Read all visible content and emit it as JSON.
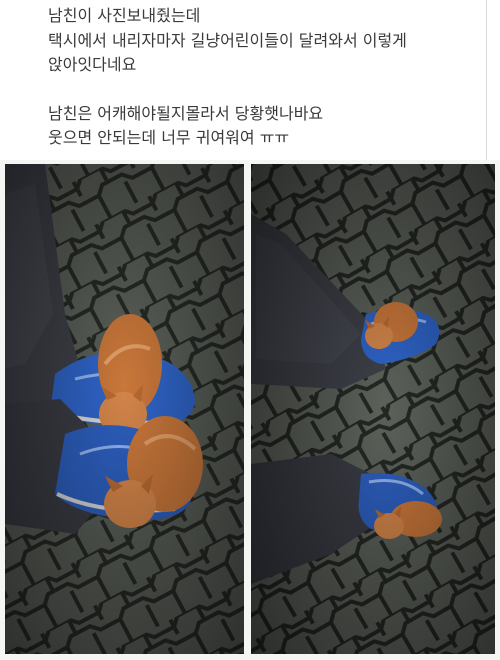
{
  "post": {
    "lines": [
      "남친이 사진보내줬는데",
      "택시에서 내리자마자 길냥어린이들이 달려와서 이렇게",
      "앉아잇다네요",
      "남친은 어캐해야될지몰라서 당황햇나바요",
      "웃으면 안되는데 너무 귀여워여 ㅠㅠ"
    ]
  },
  "photos": [
    {
      "icon": "kitten-on-shoe-photo",
      "subject": "kittens on blue sneakers"
    },
    {
      "icon": "kitten-on-shoe-photo",
      "subject": "kittens on blue sneakers"
    }
  ],
  "colors": {
    "text": "#3a3a3a",
    "pavement": "#5a5f58",
    "grout": "#262a25",
    "jeans": "#3e4048",
    "sneaker": "#2f64c8",
    "kitten": "#c9773a"
  }
}
